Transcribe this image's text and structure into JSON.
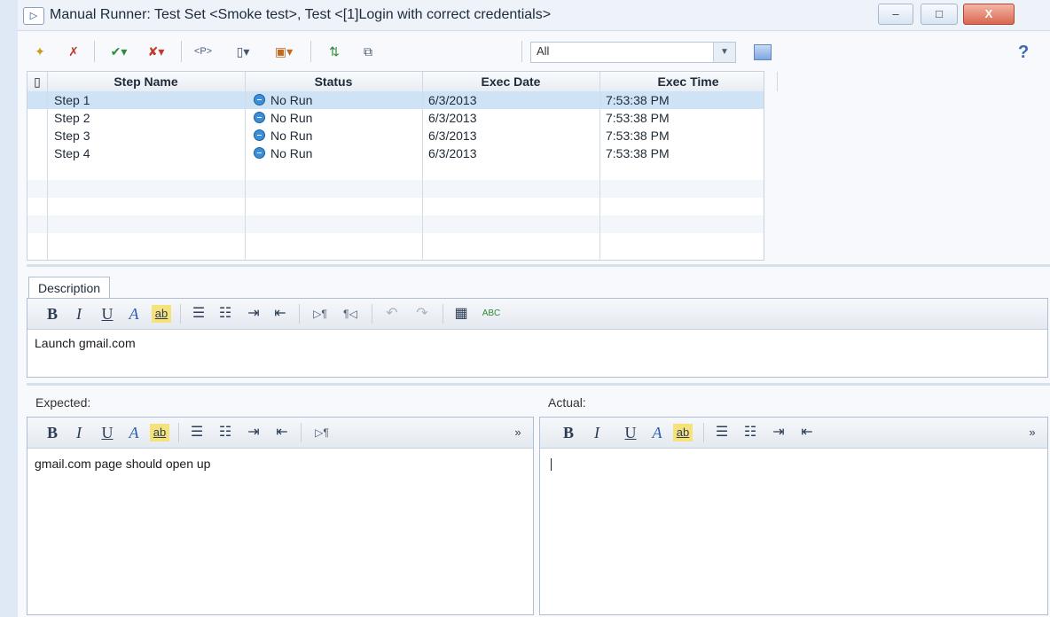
{
  "window": {
    "title": "Manual Runner: Test Set <Smoke test>, Test <[1]Login with correct credentials>",
    "title_icon": "▷",
    "controls": {
      "minimize": "–",
      "maximize": "□",
      "close": "X"
    }
  },
  "toolbar": {
    "filter_value": "All",
    "filter_dropdown": "▼",
    "help": "?",
    "icons": [
      "new-step-icon",
      "delete-step-icon",
      "pass-selected-icon",
      "fail-selected-icon",
      "parameters-icon",
      "attachments-icon",
      "new-defect-icon",
      "linked-defects-icon",
      "layout-icon"
    ],
    "param_label": "<P>"
  },
  "steps_grid": {
    "attach_header": "📎",
    "columns": [
      "Step Name",
      "Status",
      "Exec Date",
      "Exec Time"
    ],
    "rows": [
      {
        "name": "Step 1",
        "status": "No Run",
        "date": "6/3/2013",
        "time": "7:53:38 PM",
        "selected": true
      },
      {
        "name": "Step 2",
        "status": "No Run",
        "date": "6/3/2013",
        "time": "7:53:38 PM",
        "selected": false
      },
      {
        "name": "Step 3",
        "status": "No Run",
        "date": "6/3/2013",
        "time": "7:53:38 PM",
        "selected": false
      },
      {
        "name": "Step 4",
        "status": "No Run",
        "date": "6/3/2013",
        "time": "7:53:38 PM",
        "selected": false
      }
    ]
  },
  "description": {
    "tab_label": "Description",
    "text": "Launch gmail.com"
  },
  "expected": {
    "label": "Expected:",
    "text": "gmail.com page should open up"
  },
  "actual": {
    "label": "Actual:",
    "text": ""
  },
  "format": {
    "bold": "B",
    "italic": "I",
    "underline": "U",
    "color": "A",
    "highlight": "ab",
    "ltr": "▷¶",
    "rtl": "¶◁",
    "more": "»",
    "bullets": "☰",
    "numbers": "☷",
    "indent": "⇥",
    "outdent": "⇤",
    "undo": "↶",
    "redo": "↷",
    "table": "▦",
    "spell": "ABC"
  }
}
